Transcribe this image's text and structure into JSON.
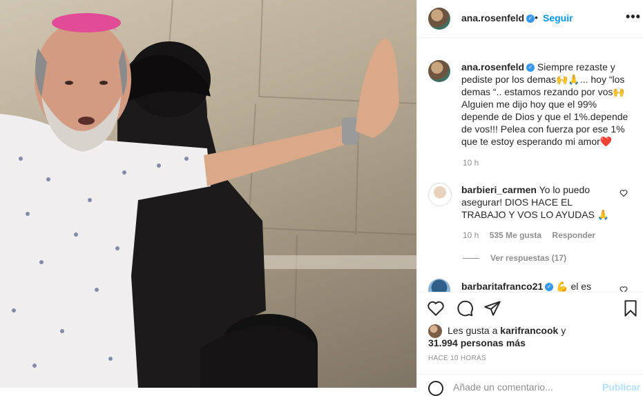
{
  "post": {
    "author": "ana.rosenfeld",
    "follow_label": "Seguir",
    "more_label": "•••",
    "separator": "•"
  },
  "caption": {
    "author": "ana.rosenfeld",
    "text": "Siempre rezaste y pediste por los demas🙌🙏... hoy “los demas “.. estamos rezando por vos🙌 Alguien me dijo hoy que el 99% depende de Dios y que el 1%.depende de vos!!! Pelea con fuerza por ese 1% que te estoy esperando mi amor❤️",
    "time": "10 h"
  },
  "comments": [
    {
      "author": "barbieri_carmen",
      "text": "Yo lo puedo asegurar! DIOS HACE EL TRABAJO Y VOS LO AYUDAS 🙏",
      "time": "10 h",
      "likes": "535 Me gusta",
      "reply_label": "Responder",
      "view_replies": "Ver respuestas (17)"
    },
    {
      "author": "barbaritafranco21",
      "text": "💪 el es"
    }
  ],
  "likes": {
    "prefix": "Les gusta a",
    "user": "karifrancook",
    "suffix": "y",
    "count": "31.994 personas más"
  },
  "timestamp": "HACE 10 HORAS",
  "add_comment": {
    "placeholder": "Añade un comentario...",
    "post_label": "Publicar"
  },
  "icons": {
    "like": "heart-icon",
    "comment": "comment-icon",
    "share": "paper-plane-icon",
    "save": "bookmark-icon"
  },
  "colors": {
    "accent": "#0095f6",
    "verified": "#3897f0",
    "muted": "#8e8e8e",
    "heart": "#ed4956"
  }
}
